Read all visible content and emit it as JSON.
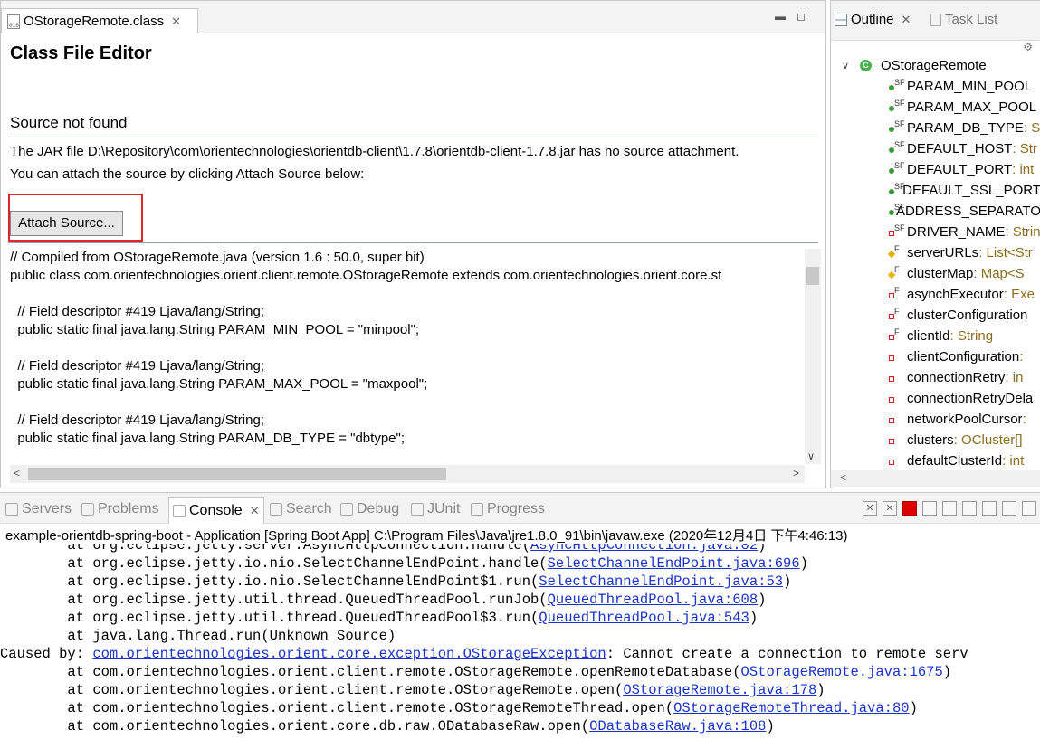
{
  "editor": {
    "tab_label": "OStorageRemote.class",
    "heading": "Class File Editor",
    "source_status": "Source not found",
    "jar_message": "The JAR file D:\\Repository\\com\\orientechnologies\\orientdb-client\\1.7.8\\orientdb-client-1.7.8.jar has no source attachment.",
    "attach_message": "You can attach the source by clicking Attach Source below:",
    "attach_button": "Attach Source...",
    "code_lines": [
      "// Compiled from OStorageRemote.java (version 1.6 : 50.0, super bit)",
      "public class com.orientechnologies.orient.client.remote.OStorageRemote extends com.orientechnologies.orient.core.st",
      "",
      "  // Field descriptor #419 Ljava/lang/String;",
      "  public static final java.lang.String PARAM_MIN_POOL = \"minpool\";",
      "",
      "  // Field descriptor #419 Ljava/lang/String;",
      "  public static final java.lang.String PARAM_MAX_POOL = \"maxpool\";",
      "",
      "  // Field descriptor #419 Ljava/lang/String;",
      "  public static final java.lang.String PARAM_DB_TYPE = \"dbtype\";"
    ]
  },
  "outline": {
    "tab_outline": "Outline",
    "tab_tasks": "Task List",
    "root": "OStorageRemote",
    "items": [
      {
        "name": "PARAM_MIN_POOL",
        "type": "",
        "icon": "static-final-public-field-icon"
      },
      {
        "name": "PARAM_MAX_POOL",
        "type": "",
        "icon": "static-final-public-field-icon"
      },
      {
        "name": "PARAM_DB_TYPE",
        "type": " : S",
        "icon": "static-final-public-field-icon"
      },
      {
        "name": "DEFAULT_HOST",
        "type": " : Str",
        "icon": "static-final-public-field-icon"
      },
      {
        "name": "DEFAULT_PORT",
        "type": " : int",
        "icon": "static-final-public-field-icon"
      },
      {
        "name": "DEFAULT_SSL_PORT",
        "type": "",
        "icon": "static-final-public-field-icon"
      },
      {
        "name": "ADDRESS_SEPARATO",
        "type": "",
        "icon": "static-final-public-field-icon"
      },
      {
        "name": "DRIVER_NAME",
        "type": " : Strin",
        "icon": "static-final-private-field-icon"
      },
      {
        "name": "serverURLs",
        "type": " : List<Str",
        "icon": "final-protected-field-icon"
      },
      {
        "name": "clusterMap",
        "type": " : Map<S",
        "icon": "final-protected-field-icon"
      },
      {
        "name": "asynchExecutor",
        "type": " : Exe",
        "icon": "final-private-field-icon"
      },
      {
        "name": "clusterConfiguration",
        "type": "",
        "icon": "final-private-field-icon"
      },
      {
        "name": "clientId",
        "type": " : String",
        "icon": "final-private-field-icon"
      },
      {
        "name": "clientConfiguration",
        "type": " :",
        "icon": "private-field-icon"
      },
      {
        "name": "connectionRetry",
        "type": " : in",
        "icon": "private-field-icon"
      },
      {
        "name": "connectionRetryDela",
        "type": "",
        "icon": "private-field-icon"
      },
      {
        "name": "networkPoolCursor",
        "type": " :",
        "icon": "private-field-icon"
      },
      {
        "name": "clusters",
        "type": " : OCluster[]",
        "icon": "private-field-icon"
      },
      {
        "name": "defaultClusterId",
        "type": " : int",
        "icon": "private-field-icon"
      }
    ]
  },
  "bottom": {
    "tabs": [
      "Servers",
      "Problems",
      "Console",
      "Search",
      "Debug",
      "JUnit",
      "Progress"
    ],
    "active_tab": "Console",
    "header": "example-orientdb-spring-boot - Application [Spring Boot App] C:\\Program Files\\Java\\jre1.8.0_91\\bin\\javaw.exe (2020年12月4日 下午4:46:13)",
    "lines": [
      {
        "prefix": "        at org.eclipse.jetty.server.AsyncHttpConnection.handle(",
        "link": "AsyncHttpConnection.java:82",
        "suffix": ")"
      },
      {
        "prefix": "        at org.eclipse.jetty.io.nio.SelectChannelEndPoint.handle(",
        "link": "SelectChannelEndPoint.java:696",
        "suffix": ")"
      },
      {
        "prefix": "        at org.eclipse.jetty.io.nio.SelectChannelEndPoint$1.run(",
        "link": "SelectChannelEndPoint.java:53",
        "suffix": ")"
      },
      {
        "prefix": "        at org.eclipse.jetty.util.thread.QueuedThreadPool.runJob(",
        "link": "QueuedThreadPool.java:608",
        "suffix": ")"
      },
      {
        "prefix": "        at org.eclipse.jetty.util.thread.QueuedThreadPool$3.run(",
        "link": "QueuedThreadPool.java:543",
        "suffix": ")"
      },
      {
        "prefix": "        at java.lang.Thread.run(Unknown Source)",
        "link": "",
        "suffix": ""
      },
      {
        "prefix": "Caused by: ",
        "link": "com.orientechnologies.orient.core.exception.OStorageException",
        "suffix": ": Cannot create a connection to remote serv"
      },
      {
        "prefix": "        at com.orientechnologies.orient.client.remote.OStorageRemote.openRemoteDatabase(",
        "link": "OStorageRemote.java:1675",
        "suffix": ")"
      },
      {
        "prefix": "        at com.orientechnologies.orient.client.remote.OStorageRemote.open(",
        "link": "OStorageRemote.java:178",
        "suffix": ")"
      },
      {
        "prefix": "        at com.orientechnologies.orient.client.remote.OStorageRemoteThread.open(",
        "link": "OStorageRemoteThread.java:80",
        "suffix": ")"
      },
      {
        "prefix": "        at com.orientechnologies.orient.core.db.raw.ODatabaseRaw.open(",
        "link": "ODatabaseRaw.java:108",
        "suffix": ")"
      }
    ]
  }
}
